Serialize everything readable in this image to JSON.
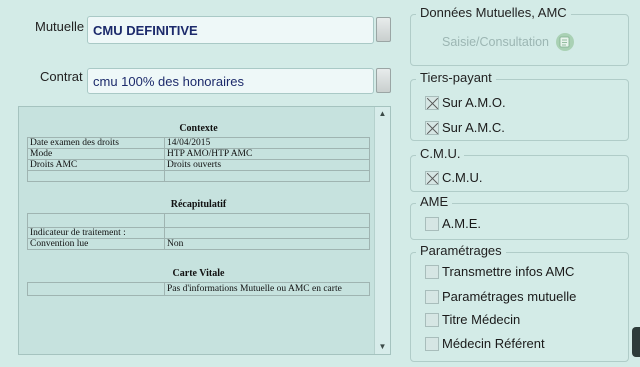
{
  "mutuelle": {
    "label": "Mutuelle",
    "value": "CMU DEFINITIVE"
  },
  "contrat": {
    "label": "Contrat",
    "value": "cmu 100% des honoraires"
  },
  "document": {
    "contexte": {
      "title": "Contexte",
      "rows": [
        [
          "Date examen des droits",
          "14/04/2015"
        ],
        [
          "Mode",
          "HTP AMO/HTP AMC"
        ],
        [
          "Droits AMC",
          "Droits ouverts"
        ],
        [
          "",
          ""
        ]
      ]
    },
    "recap": {
      "title": "Récapitulatif",
      "rows": [
        [
          "",
          ""
        ],
        [
          "Indicateur de traitement :",
          ""
        ],
        [
          "Convention lue",
          "Non"
        ]
      ]
    },
    "carte": {
      "title": "Carte Vitale",
      "rows": [
        [
          "",
          "Pas d'informations Mutuelle ou AMC en carte"
        ]
      ]
    }
  },
  "donnees": {
    "title": "Données Mutuelles, AMC",
    "saisie_label": "Saisie/Consultation",
    "icon": "document-edit-icon"
  },
  "tiers_payant": {
    "title": "Tiers-payant",
    "items": [
      {
        "label": "Sur A.M.O.",
        "checked": true
      },
      {
        "label": "Sur A.M.C.",
        "checked": true
      }
    ]
  },
  "cmu": {
    "title": "C.M.U.",
    "items": [
      {
        "label": "C.M.U.",
        "checked": true
      }
    ]
  },
  "ame": {
    "title": "AME",
    "items": [
      {
        "label": "A.M.E.",
        "checked": false
      }
    ]
  },
  "parametrages": {
    "title": "Paramétrages",
    "items": [
      {
        "label": "Transmettre infos AMC",
        "checked": false
      },
      {
        "label": "Paramétrages mutuelle",
        "checked": false
      },
      {
        "label": "Titre Médecin",
        "checked": false
      },
      {
        "label": "Médecin Référent",
        "checked": false
      }
    ]
  },
  "colors": {
    "background": "#d3ebe7",
    "field_text": "#1c2a6b",
    "disabled_text": "#9cb6b3"
  }
}
